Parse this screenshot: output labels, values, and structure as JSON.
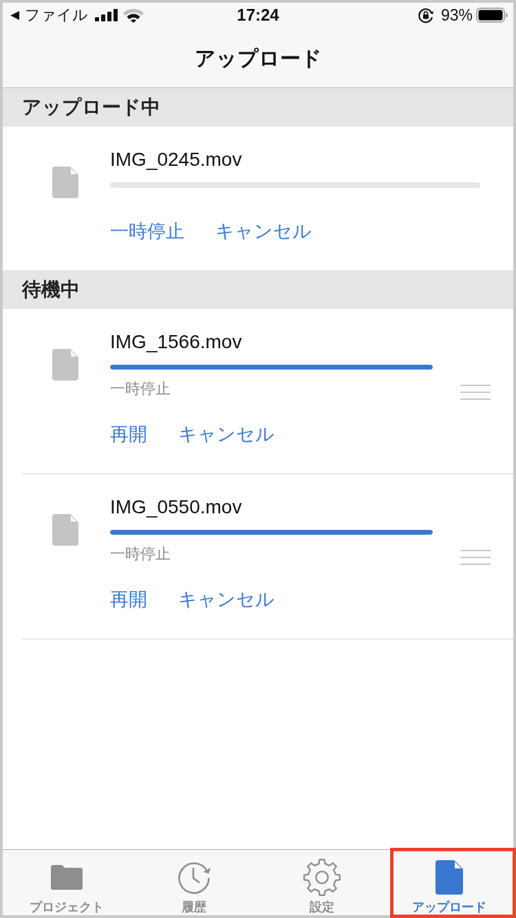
{
  "status_bar": {
    "back_arrow": "◀",
    "back_label": "ファイル",
    "time": "17:24",
    "battery": "93%"
  },
  "nav_bar": {
    "title": "アップロード"
  },
  "sections": [
    {
      "title": "アップロード中",
      "items": [
        {
          "kind": "uploading",
          "filename": "IMG_0245.mov",
          "level": 0,
          "actions": [
            "一時停止",
            "キャンセル"
          ]
        }
      ]
    },
    {
      "title": "待機中",
      "items": [
        {
          "kind": "queued",
          "filename": "IMG_1566.mov",
          "level": 1,
          "status": "一時停止",
          "actions": [
            "再開",
            "キャンセル"
          ]
        },
        {
          "kind": "queued",
          "filename": "IMG_0550.mov",
          "level": 1,
          "status": "一時停止",
          "actions": [
            "再開",
            "キャンセル"
          ]
        }
      ]
    }
  ],
  "tab_bar": {
    "tabs": [
      {
        "label": "プロジェクト",
        "selected": false,
        "highlighted": false
      },
      {
        "label": "履歴",
        "selected": false,
        "highlighted": false
      },
      {
        "label": "設定",
        "selected": false,
        "highlighted": false
      },
      {
        "label": "アップロード",
        "selected": true,
        "highlighted": true
      }
    ]
  }
}
